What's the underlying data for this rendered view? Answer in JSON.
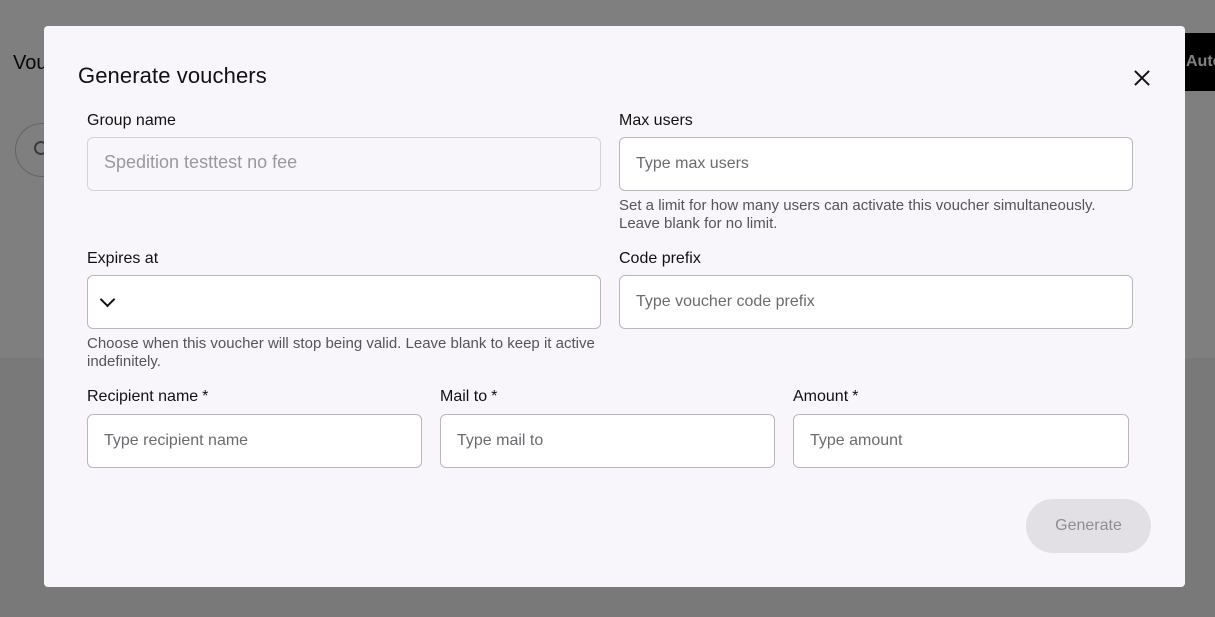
{
  "background": {
    "title": "Vou",
    "action_button": "Auto"
  },
  "modal": {
    "title": "Generate vouchers",
    "group_name": {
      "label": "Group name",
      "placeholder": "Spedition testtest no fee"
    },
    "max_users": {
      "label": "Max users",
      "placeholder": "Type max users",
      "helper": "Set a limit for how many users can activate this voucher simultaneously. Leave blank for no limit."
    },
    "expires_at": {
      "label": "Expires at",
      "helper": "Choose when this voucher will stop being valid. Leave blank to keep it active indefinitely."
    },
    "code_prefix": {
      "label": "Code prefix",
      "placeholder": "Type voucher code prefix"
    },
    "recipient_name": {
      "label": "Recipient name",
      "required_mark": "*",
      "placeholder": "Type recipient name"
    },
    "mail_to": {
      "label": "Mail to",
      "required_mark": "*",
      "placeholder": "Type mail to"
    },
    "amount": {
      "label": "Amount",
      "required_mark": "*",
      "placeholder": "Type amount"
    },
    "generate_label": "Generate"
  }
}
